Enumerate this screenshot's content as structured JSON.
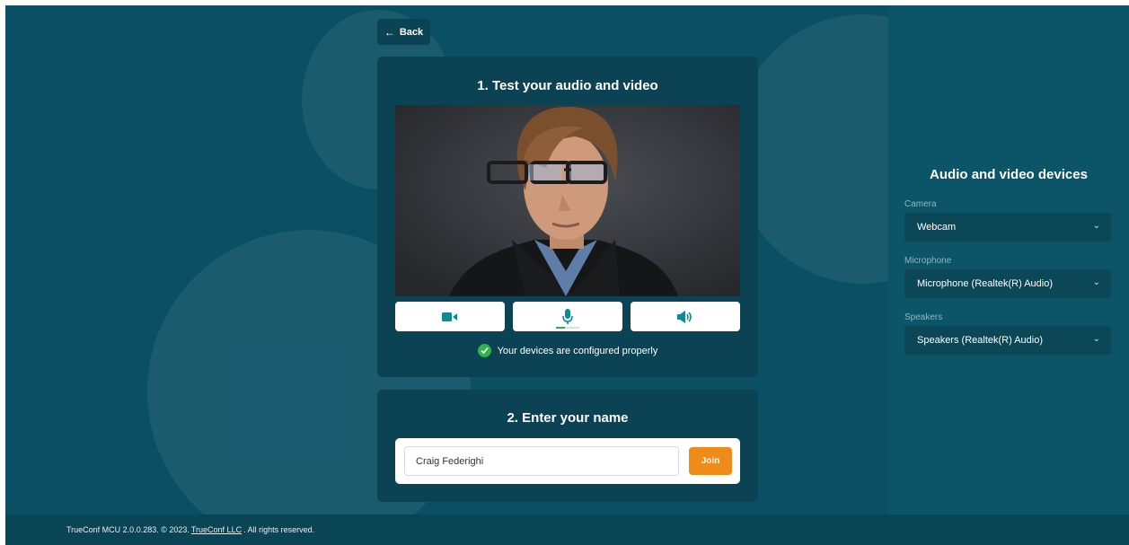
{
  "nav": {
    "back_label": "Back"
  },
  "test_section": {
    "title": "1. Test your audio and video",
    "status_text": "Your devices are configured properly",
    "mic_level": 0.4,
    "buttons": {
      "camera": "camera-icon",
      "microphone": "microphone-icon",
      "speaker": "speaker-icon"
    }
  },
  "name_section": {
    "title": "2. Enter your name",
    "name_value": "Craig Federighi",
    "join_label": "Join"
  },
  "devices": {
    "title": "Audio and video devices",
    "camera_label": "Camera",
    "camera_value": "Webcam",
    "microphone_label": "Microphone",
    "microphone_value": "Microphone (Realtek(R) Audio)",
    "speakers_label": "Speakers",
    "speakers_value": "Speakers (Realtek(R) Audio)"
  },
  "footer": {
    "prefix": "TrueConf MCU 2.0.0.283. © 2023.",
    "link": "TrueConf LLC",
    "suffix": ". All rights reserved."
  },
  "colors": {
    "background": "#0a4f64",
    "card": "#0b4254",
    "accent_button": "#f08a18",
    "icon_teal": "#0e8a95",
    "success_green": "#2fb44a"
  }
}
